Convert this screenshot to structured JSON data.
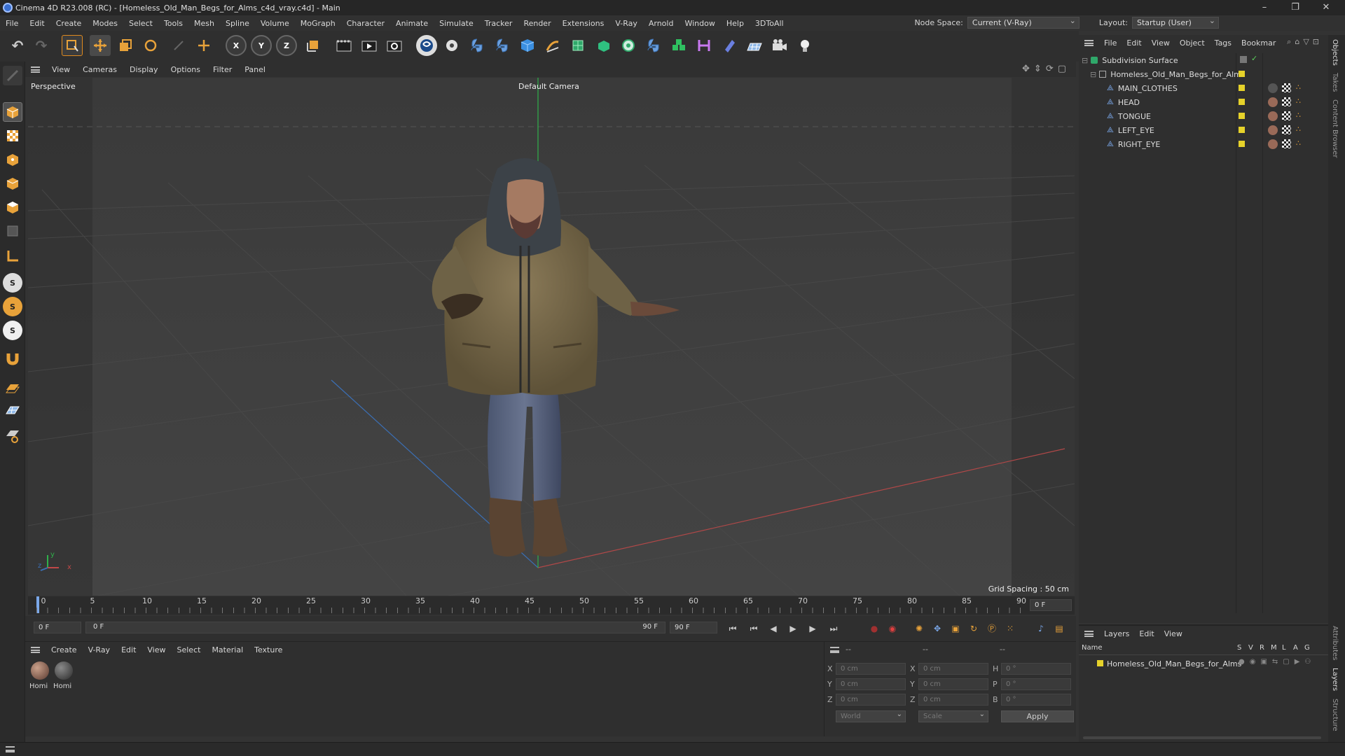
{
  "window": {
    "title": "Cinema 4D R23.008 (RC) - [Homeless_Old_Man_Begs_for_Alms_c4d_vray.c4d] - Main",
    "minimize": "–",
    "restore": "❐",
    "close": "✕"
  },
  "menubar": {
    "items": [
      "File",
      "Edit",
      "Create",
      "Modes",
      "Select",
      "Tools",
      "Mesh",
      "Spline",
      "Volume",
      "MoGraph",
      "Character",
      "Animate",
      "Simulate",
      "Tracker",
      "Render",
      "Extensions",
      "V-Ray",
      "Arnold",
      "Window",
      "Help",
      "3DToAll"
    ],
    "node_space_label": "Node Space:",
    "node_space_value": "Current (V-Ray)",
    "layout_label": "Layout:",
    "layout_value": "Startup (User)"
  },
  "viewport": {
    "menu": [
      "View",
      "Cameras",
      "Display",
      "Options",
      "Filter",
      "Panel"
    ],
    "name": "Perspective",
    "camera": "Default Camera",
    "grid_spacing": "Grid Spacing : 50 cm",
    "axis_x": "x",
    "axis_y": "y",
    "axis_z": "z"
  },
  "timeline": {
    "ticks": [
      "0",
      "5",
      "10",
      "15",
      "20",
      "25",
      "30",
      "35",
      "40",
      "45",
      "50",
      "55",
      "60",
      "65",
      "70",
      "75",
      "80",
      "85",
      "90"
    ],
    "current_frame": "0 F"
  },
  "transport": {
    "start": "0 F",
    "range_start": "0 F",
    "range_end": "90 F",
    "end": "90 F"
  },
  "material_manager": {
    "menu": [
      "Create",
      "V-Ray",
      "Edit",
      "View",
      "Select",
      "Material",
      "Texture"
    ],
    "materials": [
      "Homi",
      "Homi"
    ]
  },
  "coords": {
    "header1": "--",
    "header2": "--",
    "header3": "--",
    "rows": [
      {
        "a": "X",
        "v1": "0 cm",
        "b": "X",
        "v2": "0 cm",
        "c": "H",
        "v3": "0 °"
      },
      {
        "a": "Y",
        "v1": "0 cm",
        "b": "Y",
        "v2": "0 cm",
        "c": "P",
        "v3": "0 °"
      },
      {
        "a": "Z",
        "v1": "0 cm",
        "b": "Z",
        "v2": "0 cm",
        "c": "B",
        "v3": "0 °"
      }
    ],
    "world": "World",
    "scale": "Scale",
    "apply": "Apply"
  },
  "object_manager": {
    "menu": [
      "File",
      "Edit",
      "View",
      "Object",
      "Tags",
      "Bookmar"
    ],
    "objects": [
      {
        "name": "Subdivision Surface",
        "depth": 0
      },
      {
        "name": "Homeless_Old_Man_Begs_for_Alms",
        "depth": 1
      },
      {
        "name": "MAIN_CLOTHES",
        "depth": 2
      },
      {
        "name": "HEAD",
        "depth": 2
      },
      {
        "name": "TONGUE",
        "depth": 2
      },
      {
        "name": "LEFT_EYE",
        "depth": 2
      },
      {
        "name": "RIGHT_EYE",
        "depth": 2
      }
    ]
  },
  "layer_manager": {
    "menu": [
      "Layers",
      "Edit",
      "View"
    ],
    "col_name": "Name",
    "cols": [
      "S",
      "V",
      "R",
      "M",
      "L",
      "A",
      "G"
    ],
    "layers": [
      "Homeless_Old_Man_Begs_for_Alms"
    ]
  },
  "side_tabs": [
    "Objects",
    "Takes",
    "Content Browser",
    "Attributes",
    "Layers",
    "Structure"
  ]
}
